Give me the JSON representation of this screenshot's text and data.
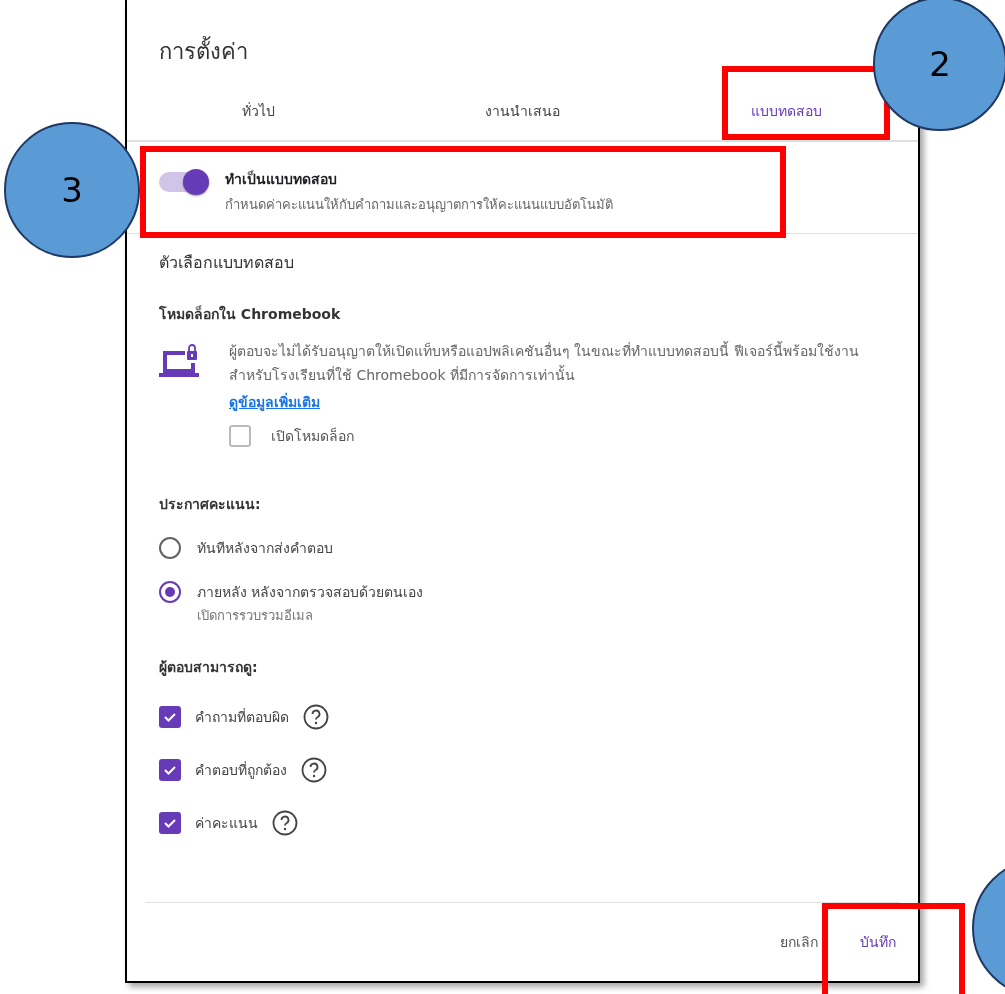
{
  "dialog": {
    "title": "การตั้งค่า",
    "tabs": [
      {
        "label": "ทั่วไป",
        "selected": false
      },
      {
        "label": "งานนำเสนอ",
        "selected": false
      },
      {
        "label": "แบบทดสอบ",
        "selected": true
      }
    ],
    "quiz_toggle": {
      "label": "ทำเป็นแบบทดสอบ",
      "description": "กำหนดค่าคะแนนให้กับคำถามและอนุญาตการให้คะแนนแบบอัตโนมัติ",
      "on": true
    },
    "section_title": "ตัวเลือกแบบทดสอบ",
    "lock_mode": {
      "heading": "โหมดล็อกใน Chromebook",
      "description": "ผู้ตอบจะไม่ได้รับอนุญาตให้เปิดแท็บหรือแอปพลิเคชันอื่นๆ ในขณะที่ทำแบบทดสอบนี้ ฟีเจอร์นี้พร้อมใช้งานสำหรับโรงเรียนที่ใช้ Chromebook ที่มีการจัดการเท่านั้น",
      "link": "ดูข้อมูลเพิ่มเติม",
      "checkbox": {
        "label": "เปิดโหมดล็อก",
        "checked": false
      }
    },
    "release_grade": {
      "heading": "ประกาศคะแนน:",
      "options": [
        {
          "label": "ทันทีหลังจากส่งคำตอบ",
          "selected": false
        },
        {
          "label": "ภายหลัง หลังจากตรวจสอบด้วยตนเอง",
          "sublabel": "เปิดการรวบรวมอีเมล",
          "selected": true
        }
      ]
    },
    "respondents_see": {
      "heading": "ผู้ตอบสามารถดู:",
      "options": [
        {
          "label": "คำถามที่ตอบผิด",
          "checked": true
        },
        {
          "label": "คำตอบที่ถูกต้อง",
          "checked": true
        },
        {
          "label": "ค่าคะแนน",
          "checked": true
        }
      ]
    },
    "buttons": [
      {
        "label": "ยกเลิก",
        "kind": "cancel"
      },
      {
        "label": "บันทึก",
        "kind": "primary"
      }
    ]
  },
  "callouts": [
    {
      "label": "2"
    },
    {
      "label": "3"
    }
  ]
}
